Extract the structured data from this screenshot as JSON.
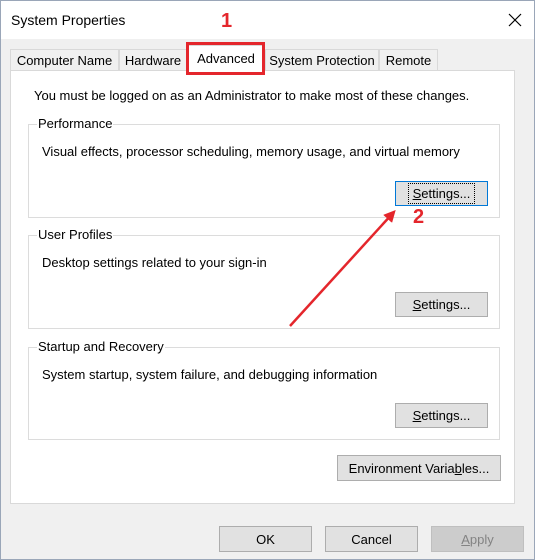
{
  "window": {
    "title": "System Properties",
    "close_icon": "close-icon"
  },
  "tabs": [
    {
      "label": "Computer Name",
      "active": false
    },
    {
      "label": "Hardware",
      "active": false
    },
    {
      "label": "Advanced",
      "active": true
    },
    {
      "label": "System Protection",
      "active": false
    },
    {
      "label": "Remote",
      "active": false
    }
  ],
  "advanced": {
    "admin_note": "You must be logged on as an Administrator to make most of these changes.",
    "groups": [
      {
        "title": "Performance",
        "description": "Visual effects, processor scheduling, memory usage, and virtual memory",
        "button_prefix": "S",
        "button_rest": "ettings..."
      },
      {
        "title": "User Profiles",
        "description": "Desktop settings related to your sign-in",
        "button_prefix": "S",
        "button_rest": "ettings..."
      },
      {
        "title": "Startup and Recovery",
        "description": "System startup, system failure, and debugging information",
        "button_prefix": "S",
        "button_rest": "ettings..."
      }
    ],
    "env_button_prefix": "Environment Varia",
    "env_button_accel": "b",
    "env_button_rest": "les..."
  },
  "footer": {
    "ok": "OK",
    "cancel": "Cancel",
    "apply_accel": "A",
    "apply_rest": "pply"
  },
  "annotations": {
    "step1": "1",
    "step2": "2",
    "color": "#e4262c"
  },
  "colors": {
    "focus_border": "#0078d7",
    "button_bg": "#e1e1e1",
    "dialog_bg": "#f0f0f0"
  }
}
